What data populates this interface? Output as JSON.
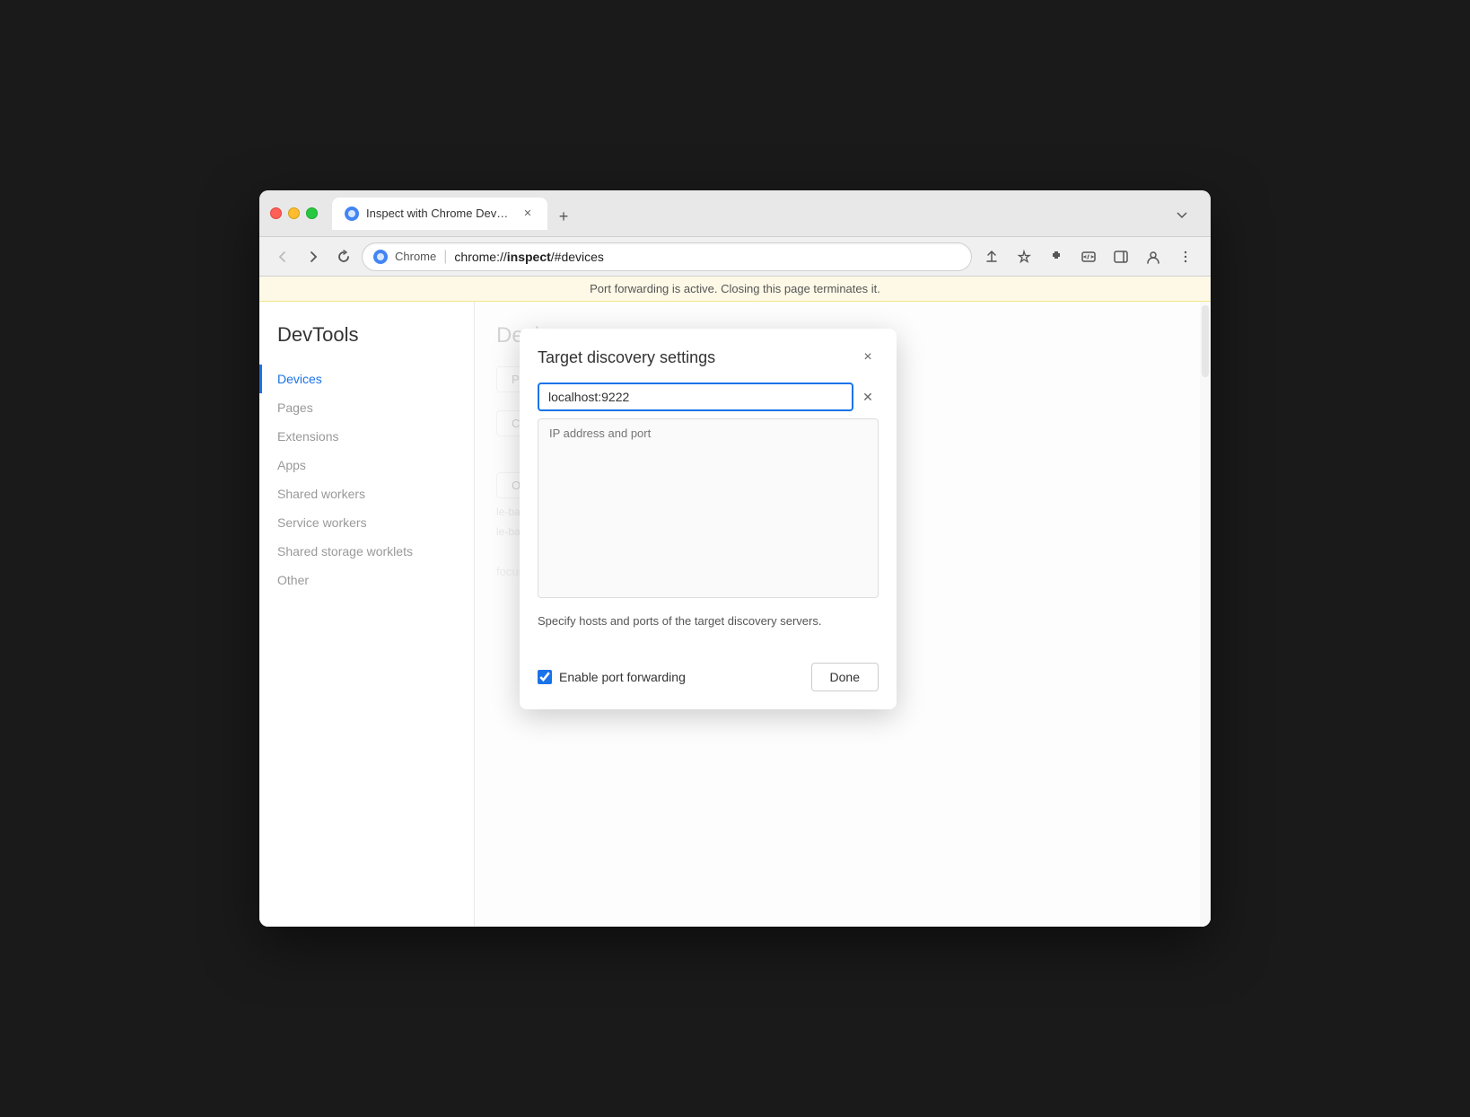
{
  "browser": {
    "tab": {
      "title": "Inspect with Chrome Develope",
      "url_site": "Chrome",
      "url_path": "chrome://inspect/#devices",
      "url_bold": "inspect",
      "favicon_color": "#4285f4"
    },
    "notification": {
      "text": "Port forwarding is active. Closing this page terminates it."
    },
    "toolbar": {
      "back_title": "back",
      "forward_title": "forward",
      "reload_title": "reload"
    }
  },
  "sidebar": {
    "title": "DevTools",
    "items": [
      {
        "label": "Devices",
        "active": true
      },
      {
        "label": "Pages",
        "active": false
      },
      {
        "label": "Extensions",
        "active": false
      },
      {
        "label": "Apps",
        "active": false
      },
      {
        "label": "Shared workers",
        "active": false
      },
      {
        "label": "Service workers",
        "active": false
      },
      {
        "label": "Shared storage worklets",
        "active": false
      },
      {
        "label": "Other",
        "active": false
      }
    ]
  },
  "main": {
    "page_title": "Devices",
    "buttons": {
      "port_forwarding": "Port forwarding...",
      "configure": "Configure..."
    },
    "open_button": "Open",
    "trace_link": "trace",
    "background_url1": "le-bar?paramsencoded=",
    "background_url2": "le-bar?paramsencoded="
  },
  "dialog": {
    "title": "Target discovery settings",
    "close_label": "×",
    "host_input_value": "localhost:9222",
    "host_placeholder": "IP address and port",
    "description": "Specify hosts and ports of the target discovery servers.",
    "enable_port_forwarding_label": "Enable port forwarding",
    "done_button": "Done",
    "port_forwarding_checked": true
  }
}
